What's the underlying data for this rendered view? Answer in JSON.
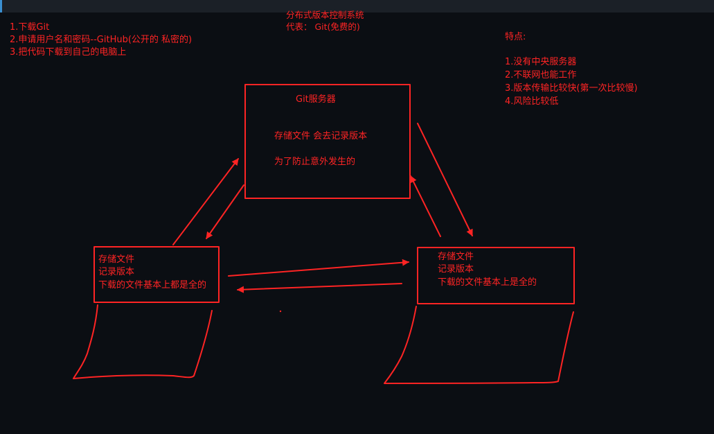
{
  "colors": {
    "background": "#0b0e13",
    "ink": "#ff2424",
    "topbar": "#1b2027",
    "topbar_accent": "#3a8fd1"
  },
  "steps": [
    "1.下载Git",
    "2.申请用户名和密码--GitHub(公开的 私密的)",
    "3.把代码下载到自己的电脑上"
  ],
  "header": {
    "title": "分布式版本控制系统",
    "representative": "代表：  Git(免费的)"
  },
  "features": {
    "heading": "特点:",
    "items": [
      "1.没有中央服务器",
      "2.不联网也能工作",
      "3.版本传输比较快(第一次比较慢)",
      "4.风险比较低"
    ]
  },
  "server": {
    "title": "Git服务器",
    "line1": "存储文件   会去记录版本",
    "line2": "为了防止意外发生的"
  },
  "left_client": {
    "line1": "存储文件",
    "line2": "记录版本",
    "line3": "下载的文件基本上都是全的"
  },
  "right_client": {
    "line1": "存储文件",
    "line2": "记录版本",
    "line3": "下载的文件基本上是全的"
  }
}
